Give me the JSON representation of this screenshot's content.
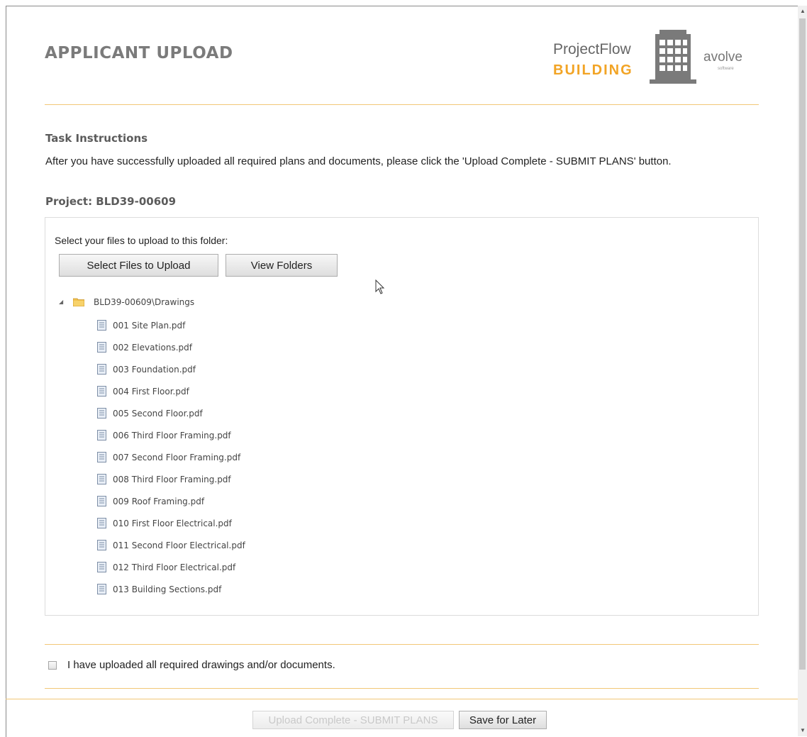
{
  "header": {
    "title": "APPLICANT UPLOAD",
    "brand": {
      "product_line1": "ProjectFlow",
      "product_line2": "BUILDING",
      "company": "avolve",
      "company_sub": "software"
    }
  },
  "task": {
    "heading": "Task Instructions",
    "text": "After you have successfully uploaded all required plans and documents, please click the 'Upload Complete - SUBMIT PLANS' button."
  },
  "project": {
    "heading": "Project: BLD39-00609"
  },
  "upload": {
    "select_label": "Select your files to upload to this folder:",
    "select_button": "Select Files to Upload",
    "view_folders_button": "View Folders",
    "folder": {
      "name": "BLD39-00609\\Drawings",
      "expanded": true,
      "files": [
        "001 Site Plan.pdf",
        "002 Elevations.pdf",
        "003 Foundation.pdf",
        "004 First Floor.pdf",
        "005 Second Floor.pdf",
        "006 Third Floor Framing.pdf",
        "007 Second Floor Framing.pdf",
        "008 Third Floor Framing.pdf",
        "009 Roof Framing.pdf",
        "010 First Floor Electrical.pdf",
        "011 Second Floor Electrical.pdf",
        "012 Third Floor Electrical.pdf",
        "013 Building Sections.pdf"
      ]
    }
  },
  "confirm": {
    "label": "I have uploaded all required drawings and/or documents.",
    "checked": false
  },
  "footer": {
    "submit_button": "Upload Complete - SUBMIT PLANS",
    "submit_disabled": true,
    "save_button": "Save for Later"
  },
  "colors": {
    "accent": "#f2a425",
    "rule": "#f2c777",
    "heading_gray": "#7b7b7b"
  }
}
